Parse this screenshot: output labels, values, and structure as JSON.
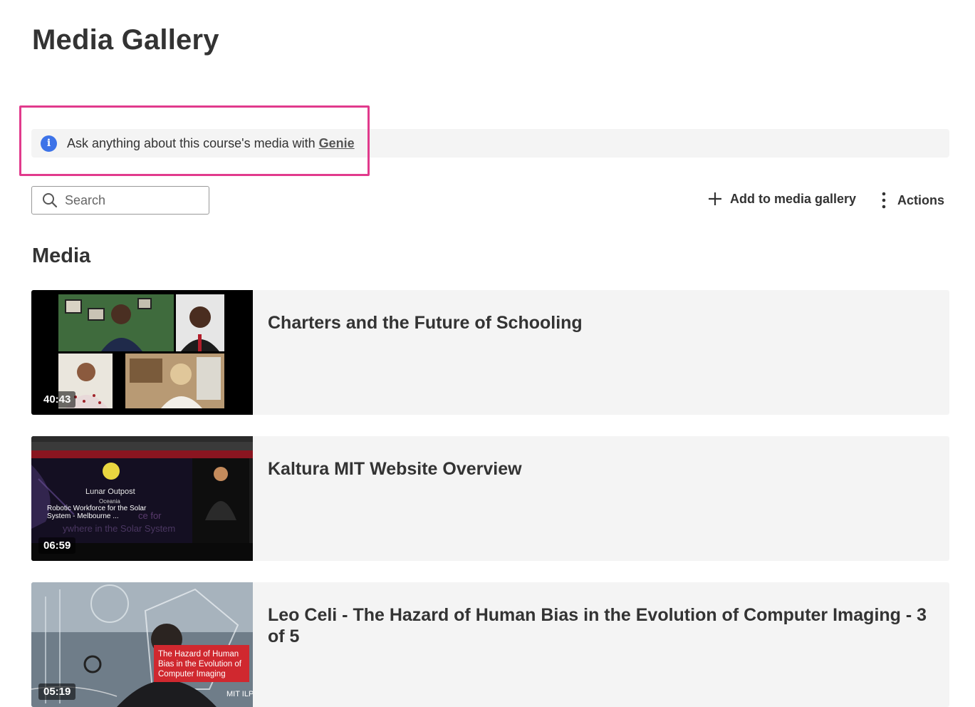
{
  "page": {
    "title": "Media Gallery"
  },
  "banner": {
    "text": "Ask anything about this course's media with",
    "link_label": "Genie",
    "icon": "info-icon",
    "highlight_color": "#e13a8c"
  },
  "search": {
    "placeholder": "Search",
    "value": ""
  },
  "toolbar": {
    "add_label": "Add to media gallery",
    "actions_label": "Actions"
  },
  "section": {
    "title": "Media"
  },
  "media": [
    {
      "title": "Charters and the Future of Schooling",
      "duration": "40:43"
    },
    {
      "title": "Kaltura MIT Website Overview",
      "duration": "06:59",
      "thumb_text": {
        "brand": "Lunar Outpost",
        "sub": "Oceania",
        "caption": "Robotic Workforce for the Solar System - Melbourne ...",
        "bg_line1": "ce for",
        "bg_line2": "ywhere in the Solar System"
      }
    },
    {
      "title": "Leo Celi - The Hazard of Human Bias in the Evolution of Computer Imaging - 3 of 5",
      "duration": "05:19",
      "thumb_text": {
        "red_label": "The Hazard of Human Bias in the Evolution of Computer Imaging",
        "logo": "MIT ILP"
      }
    }
  ],
  "colors": {
    "accent": "#3d73e8",
    "card_bg": "#f4f4f4",
    "text": "#333333"
  }
}
